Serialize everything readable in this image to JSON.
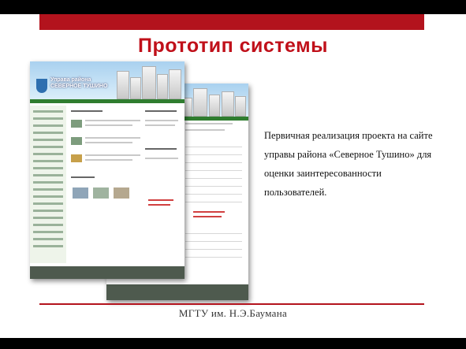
{
  "slide": {
    "title": "Прототип системы",
    "description": "Первичная реализация проекта на сайте управы района «Северное Тушино» для оценки заинтересованности пользователей.",
    "footer": "МГТУ им. Н.Э.Баумана",
    "colors": {
      "accent": "#b3131d",
      "title": "#c0101a"
    }
  },
  "mockup": {
    "site_title": "Управа района\nСЕВЕРНОЕ ТУШИНО"
  }
}
